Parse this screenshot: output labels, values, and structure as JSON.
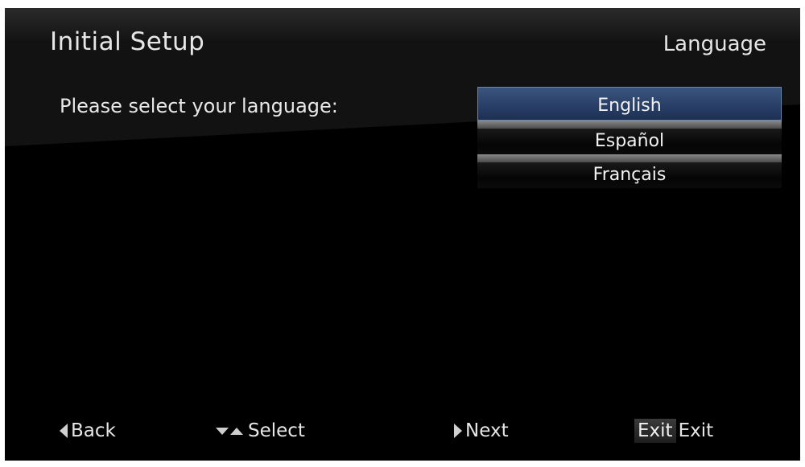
{
  "header": {
    "title": "Initial Setup",
    "section": "Language"
  },
  "prompt": "Please select your language:",
  "languages": [
    {
      "label": "English",
      "selected": true
    },
    {
      "label": "Español",
      "selected": false
    },
    {
      "label": "Français",
      "selected": false
    }
  ],
  "footer": {
    "back": "Back",
    "select": "Select",
    "next": "Next",
    "exit_key": "Exit",
    "exit": "Exit"
  },
  "colors": {
    "background": "#000000",
    "selected_item": "#2a4068",
    "text": "#e6e6e6"
  }
}
